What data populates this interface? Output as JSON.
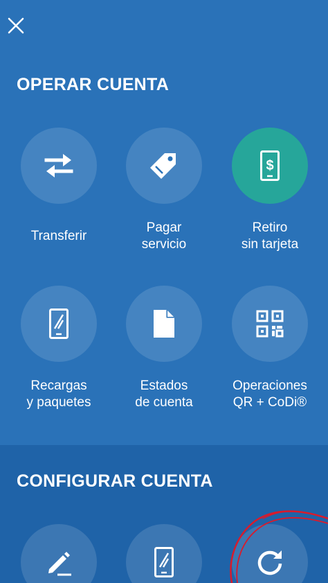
{
  "colors": {
    "background_top": "#2a72b8",
    "background_bottom": "#1f63a8",
    "active_circle": "#26a69a",
    "annotation_stroke": "#d81b2c"
  },
  "header": {
    "close_icon": "close-icon"
  },
  "operar": {
    "title": "OPERAR CUENTA",
    "items": [
      {
        "label": "Transferir",
        "icon": "transfer-arrows-icon"
      },
      {
        "label": "Pagar\nservicio",
        "icon": "tag-icon"
      },
      {
        "label": "Retiro\nsin tarjeta",
        "icon": "phone-dollar-icon",
        "active": true
      },
      {
        "label": "Recargas\ny paquetes",
        "icon": "phone-icon"
      },
      {
        "label": "Estados\nde cuenta",
        "icon": "document-icon"
      },
      {
        "label": "Operaciones\nQR + CoDi®",
        "icon": "qr-code-icon"
      }
    ]
  },
  "configurar": {
    "title": "CONFIGURAR CUENTA",
    "items": [
      {
        "icon": "pencil-icon"
      },
      {
        "icon": "phone-icon"
      },
      {
        "icon": "refresh-icon"
      }
    ]
  }
}
